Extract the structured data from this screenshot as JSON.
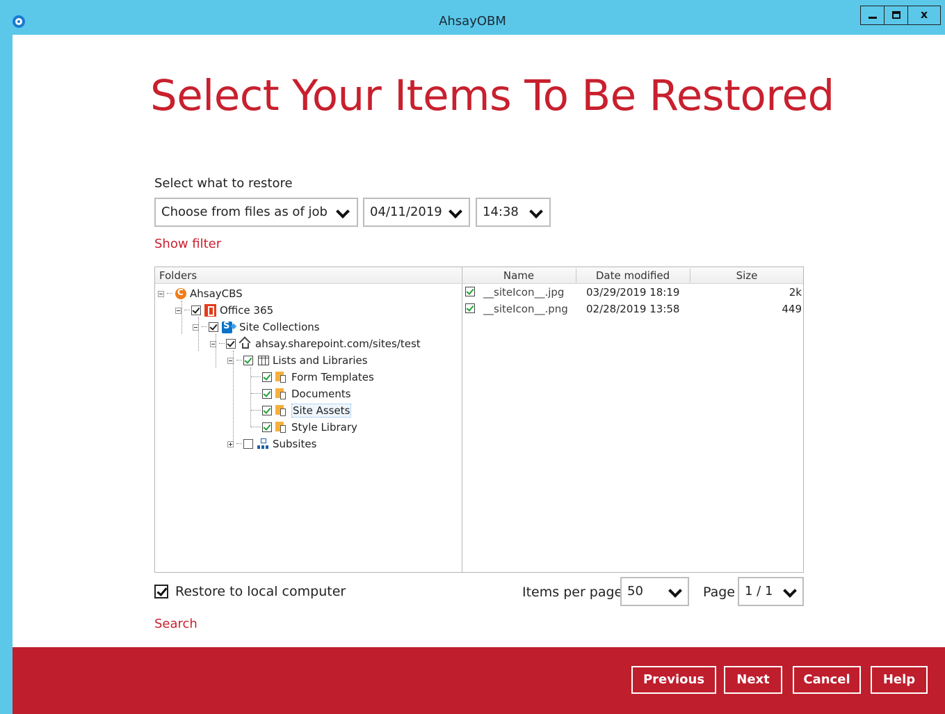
{
  "window": {
    "title": "AhsayOBM"
  },
  "heading": "Select Your Items To Be Restored",
  "restore_selector": {
    "label": "Select what to restore",
    "mode": "Choose from files as of job",
    "date": "04/11/2019",
    "time": "14:38"
  },
  "show_filter": "Show filter",
  "folders_header": "Folders",
  "files_columns": {
    "name": "Name",
    "date": "Date modified",
    "size": "Size"
  },
  "tree": [
    {
      "label": "AhsayCBS",
      "icon": "ahsaycbs-icon",
      "checked": null
    },
    {
      "label": "Office 365",
      "icon": "office365-icon",
      "checked": true
    },
    {
      "label": "Site Collections",
      "icon": "sharepoint-icon",
      "checked": true
    },
    {
      "label": "ahsay.sharepoint.com/sites/test",
      "icon": "home-icon",
      "checked": true
    },
    {
      "label": "Lists and Libraries",
      "icon": "list-icon",
      "checked": true
    },
    {
      "label": "Form Templates",
      "icon": "library-icon",
      "checked": true
    },
    {
      "label": "Documents",
      "icon": "library-icon",
      "checked": true
    },
    {
      "label": "Site Assets",
      "icon": "library-icon",
      "checked": true,
      "selected": true
    },
    {
      "label": "Style Library",
      "icon": "library-icon",
      "checked": true
    },
    {
      "label": "Subsites",
      "icon": "subsites-icon",
      "checked": false
    }
  ],
  "files": [
    {
      "name": "__siteIcon__.jpg",
      "date": "03/29/2019 18:19",
      "size": "2k"
    },
    {
      "name": "__siteIcon__.png",
      "date": "02/28/2019 13:58",
      "size": "449"
    }
  ],
  "restore_local": {
    "label": "Restore to local computer",
    "checked": true
  },
  "pagination": {
    "items_per_page_label": "Items per page",
    "items_per_page": "50",
    "page_label": "Page",
    "page": "1 / 1"
  },
  "search_link": "Search",
  "footer_buttons": {
    "previous": "Previous",
    "next": "Next",
    "cancel": "Cancel",
    "help": "Help"
  },
  "colors": {
    "titlebar": "#5bc8ea",
    "accent": "#c8202e",
    "footer": "#bf1e2d",
    "check_green": "#1ea234"
  }
}
